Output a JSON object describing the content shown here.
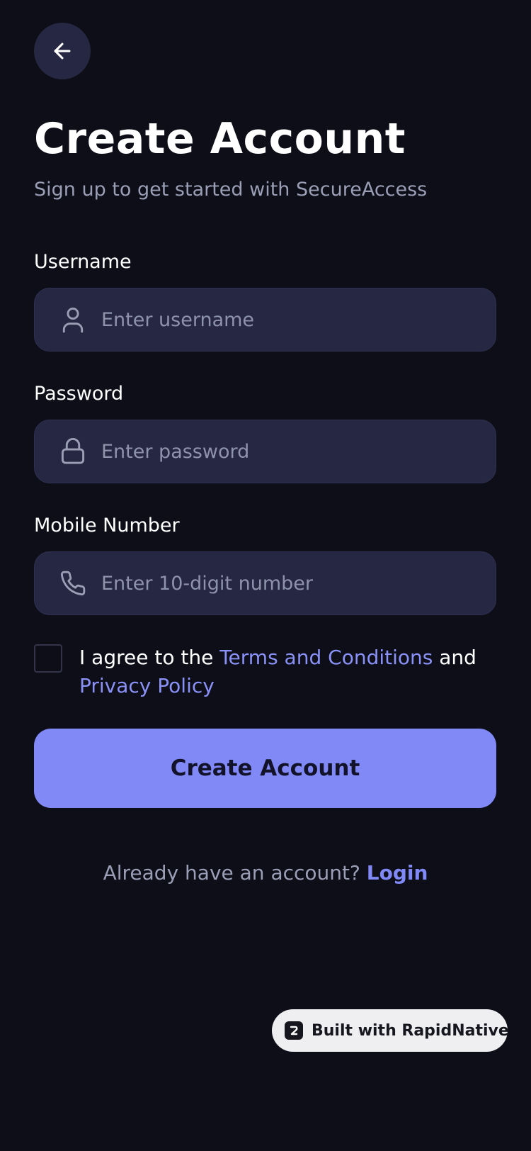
{
  "header": {
    "back_icon": "arrow-left-icon",
    "title": "Create Account",
    "subtitle": "Sign up to get started with SecureAccess"
  },
  "form": {
    "username": {
      "label": "Username",
      "placeholder": "Enter username",
      "value": "",
      "icon": "user-icon"
    },
    "password": {
      "label": "Password",
      "placeholder": "Enter password",
      "value": "",
      "icon": "lock-icon"
    },
    "mobile": {
      "label": "Mobile Number",
      "placeholder": "Enter 10-digit number",
      "value": "",
      "icon": "phone-icon"
    }
  },
  "terms": {
    "checked": false,
    "prefix": "I agree to the ",
    "terms_link": "Terms and Conditions",
    "middle": " and ",
    "privacy_link": "Privacy Policy"
  },
  "actions": {
    "create_label": "Create Account"
  },
  "footer": {
    "prompt": "Already have an account? ",
    "login_link": "Login"
  },
  "badge": {
    "logo_icon": "rapidnative-logo-icon",
    "text": "Built with RapidNative"
  },
  "colors": {
    "background": "#0d0e18",
    "field": "#262742",
    "accent": "#8189f6",
    "muted_text": "#9a9fb6",
    "placeholder": "#8e93ac"
  }
}
